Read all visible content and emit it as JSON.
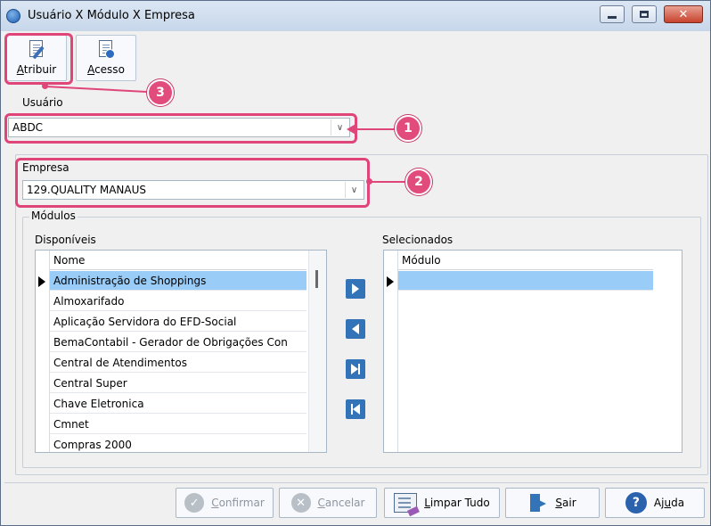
{
  "window": {
    "title": "Usuário X Módulo X Empresa",
    "controls": {
      "close": "✕"
    }
  },
  "toolbar": {
    "assign_label_u": "A",
    "assign_label_rest": "tribuir",
    "access_label_u": "A",
    "access_label_rest": "cesso"
  },
  "user": {
    "label": "Usuário",
    "value": "ABDC"
  },
  "company": {
    "label": "Empresa",
    "value": "129.QUALITY MANAUS"
  },
  "modules": {
    "group_label": "Módulos",
    "available": {
      "label": "Disponíveis",
      "column": "Nome",
      "rows": [
        "Administração de Shoppings",
        "Almoxarifado",
        "Aplicação Servidora do EFD-Social",
        "BemaContabil - Gerador de Obrigações Con",
        "Central de Atendimentos",
        "Central Super",
        "Chave Eletronica",
        "Cmnet",
        "Compras 2000"
      ],
      "selected_index": 0
    },
    "selected": {
      "label": "Selecionados",
      "column": "Módulo",
      "rows": [
        ""
      ]
    }
  },
  "footer": {
    "confirm_u": "C",
    "confirm_rest": "onfirmar",
    "cancel_u": "C",
    "cancel_rest": "ancelar",
    "clear_u": "L",
    "clear_rest": "impar Tudo",
    "exit_u": "S",
    "exit_rest": "air",
    "help_pre": "Aj",
    "help_u": "u",
    "help_rest": "da"
  },
  "callouts": [
    "1",
    "2",
    "3"
  ],
  "colors": {
    "callout": "#e0457a",
    "selection": "#99ccf7",
    "move_button": "#3373b8"
  }
}
